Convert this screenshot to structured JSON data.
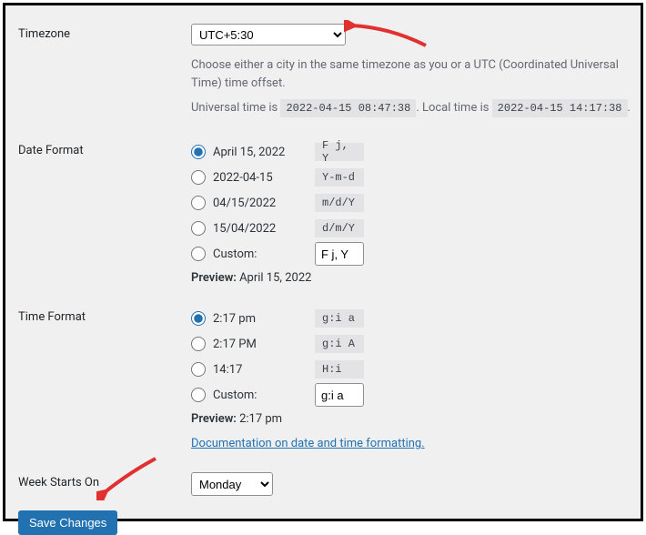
{
  "timezone": {
    "label": "Timezone",
    "value": "UTC+5:30",
    "help": "Choose either a city in the same timezone as you or a UTC (Coordinated Universal Time) time offset.",
    "universal_prefix": "Universal time is ",
    "universal_value": "2022-04-15 08:47:38",
    "local_prefix": ". Local time is ",
    "local_value": "2022-04-15 14:17:38",
    "local_suffix": "."
  },
  "date_format": {
    "label": "Date Format",
    "options": [
      {
        "display": "April 15, 2022",
        "code": "F j, Y",
        "checked": true
      },
      {
        "display": "2022-04-15",
        "code": "Y-m-d",
        "checked": false
      },
      {
        "display": "04/15/2022",
        "code": "m/d/Y",
        "checked": false
      },
      {
        "display": "15/04/2022",
        "code": "d/m/Y",
        "checked": false
      }
    ],
    "custom_label": "Custom:",
    "custom_value": "F j, Y",
    "preview_label": "Preview:",
    "preview_value": "April 15, 2022"
  },
  "time_format": {
    "label": "Time Format",
    "options": [
      {
        "display": "2:17 pm",
        "code": "g:i a",
        "checked": true
      },
      {
        "display": "2:17 PM",
        "code": "g:i A",
        "checked": false
      },
      {
        "display": "14:17",
        "code": "H:i",
        "checked": false
      }
    ],
    "custom_label": "Custom:",
    "custom_value": "g:i a",
    "preview_label": "Preview:",
    "preview_value": "2:17 pm",
    "doc_link": "Documentation on date and time formatting."
  },
  "week_starts": {
    "label": "Week Starts On",
    "value": "Monday"
  },
  "save_button": "Save Changes"
}
